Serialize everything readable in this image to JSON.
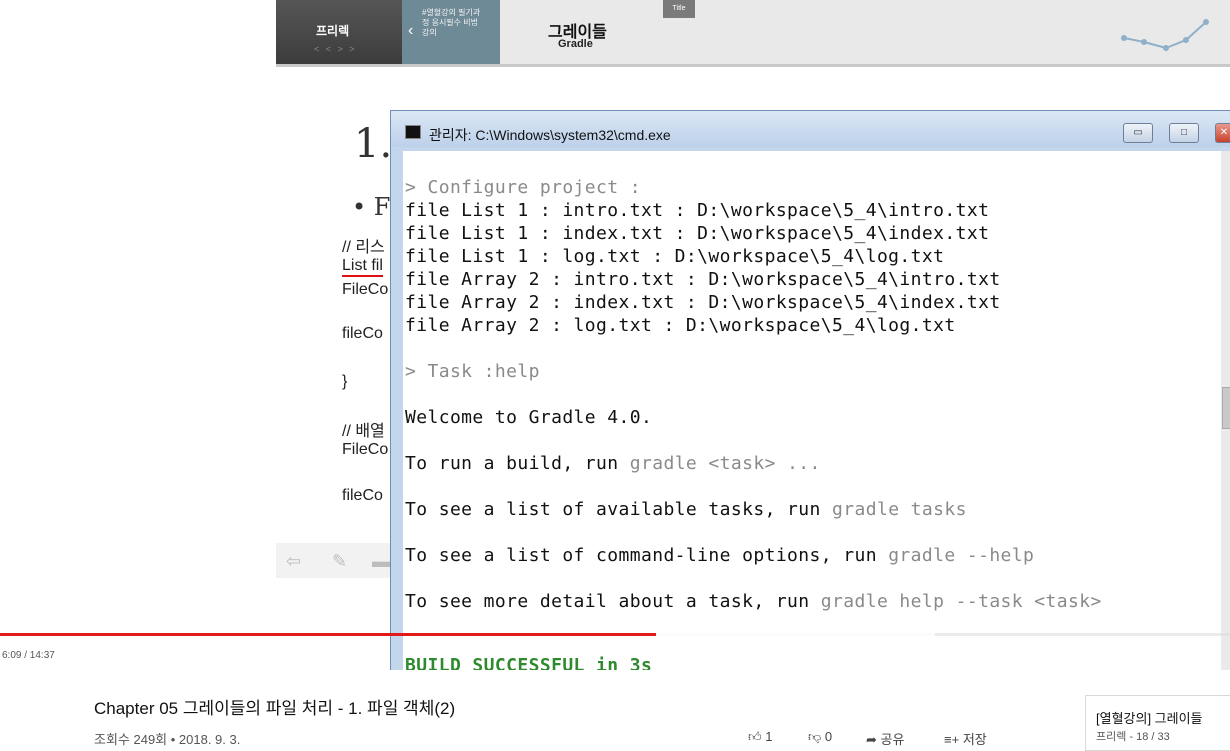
{
  "slide": {
    "brand": "프리렉",
    "brand_arrows": "< < > >",
    "series_text": "#열혈강의 필기과정 응시필수 비법강의",
    "banner_title": "그레이들",
    "banner_subtitle": "Gradle",
    "title_tab": "Title",
    "heading_num": "1.",
    "bullet": "• F",
    "code_lines": [
      "// 리스",
      "List fil",
      "FileCo",
      "fileCo",
      "}",
      "// 배열",
      "FileCo",
      "fileCo"
    ]
  },
  "cmd": {
    "title": "관리자: C:\\Windows\\system32\\cmd.exe",
    "minimize": "▭",
    "maximize": "□",
    "close": "✕",
    "lines": [
      {
        "text": "> Configure project :",
        "style": "gray"
      },
      {
        "text": "file List 1 : intro.txt : D:\\workspace\\5_4\\intro.txt",
        "style": ""
      },
      {
        "text": "file List 1 : index.txt : D:\\workspace\\5_4\\index.txt",
        "style": ""
      },
      {
        "text": "file List 1 : log.txt : D:\\workspace\\5_4\\log.txt",
        "style": ""
      },
      {
        "text": "file Array 2 : intro.txt : D:\\workspace\\5_4\\intro.txt",
        "style": ""
      },
      {
        "text": "file Array 2 : index.txt : D:\\workspace\\5_4\\index.txt",
        "style": ""
      },
      {
        "text": "file Array 2 : log.txt : D:\\workspace\\5_4\\log.txt",
        "style": ""
      },
      {
        "text": "> Task :help",
        "style": "gray"
      },
      {
        "text": "Welcome to Gradle 4.0.",
        "style": ""
      },
      {
        "text": "To run a build, run ",
        "style": "",
        "gray_suffix": "gradle <task> ..."
      },
      {
        "text": "To see a list of available tasks, run ",
        "style": "",
        "gray_suffix": "gradle tasks"
      },
      {
        "text": "To see a list of command-line options, run ",
        "style": "",
        "gray_suffix": "gradle --help"
      },
      {
        "text": "To see more detail about a task, run ",
        "style": "",
        "gray_suffix": "gradle help --task <task>"
      },
      {
        "text": "BUILD SUCCESSFUL in 3s",
        "style": "success"
      }
    ]
  },
  "player": {
    "time": "6:09 / 14:37",
    "progress_played": 0.533,
    "progress_buffered": 0.76,
    "accent": "#e31a1a"
  },
  "video": {
    "title": "Chapter 05 그레이들의 파일 처리 - 1. 파일 객체(2)",
    "meta": "조회수 249회 • 2018. 9. 3.",
    "like_count": "1",
    "dislike_count": "0",
    "share_label": "공유",
    "save_label": "저장"
  },
  "playlist": {
    "title": "[열혈강의] 그레이들",
    "meta": "프리렉 - 18 / 33"
  }
}
